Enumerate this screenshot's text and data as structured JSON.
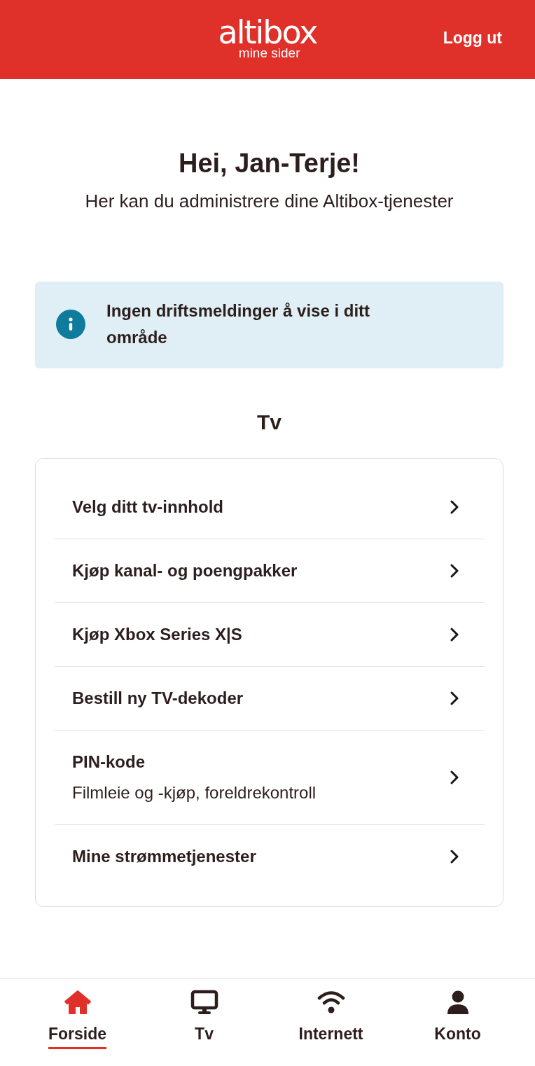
{
  "header": {
    "logo": {
      "name": "altibox",
      "tagline": "mine sider"
    },
    "logout": "Logg ut"
  },
  "greeting": {
    "title": "Hei, Jan-Terje!",
    "subtitle": "Her kan du administrere dine Altibox-tjenester"
  },
  "notice": {
    "text": "Ingen driftsmeldinger å vise i ditt område"
  },
  "tv_section": {
    "heading": "Tv",
    "items": [
      {
        "title": "Velg ditt tv-innhold"
      },
      {
        "title": "Kjøp kanal- og poengpakker"
      },
      {
        "title": "Kjøp Xbox Series X|S"
      },
      {
        "title": "Bestill ny TV-dekoder"
      },
      {
        "title": "PIN-kode",
        "subtitle": "Filmleie og -kjøp, foreldrekontroll"
      },
      {
        "title": "Mine strømmetjenester"
      }
    ]
  },
  "bottom_nav": [
    {
      "label": "Forside",
      "selected": true
    },
    {
      "label": "Tv",
      "selected": false
    },
    {
      "label": "Internett",
      "selected": false
    },
    {
      "label": "Konto",
      "selected": false
    }
  ]
}
